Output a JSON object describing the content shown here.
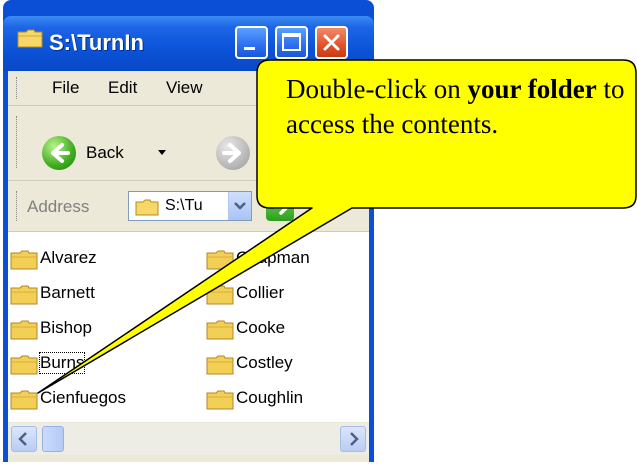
{
  "caption_fragment": "y",
  "window": {
    "title": "S:\\TurnIn"
  },
  "menu": {
    "items": [
      "File",
      "Edit",
      "View"
    ]
  },
  "toolbar": {
    "back_label": "Back"
  },
  "address": {
    "label": "Address",
    "value": "S:\\Tu"
  },
  "files": [
    "Alvarez",
    "Barnett",
    "Bishop",
    "Burns",
    "Cienfuegos",
    "Chapman",
    "Collier",
    "Cooke",
    "Costley",
    "Coughlin"
  ],
  "callout": {
    "text_before": "Double-click on ",
    "text_bold": "your folder",
    "text_after": " to access the contents."
  },
  "colors": {
    "title_bar": "#0b53d8",
    "callout_fill": "#ffff00",
    "folder": "#f2cf55"
  }
}
